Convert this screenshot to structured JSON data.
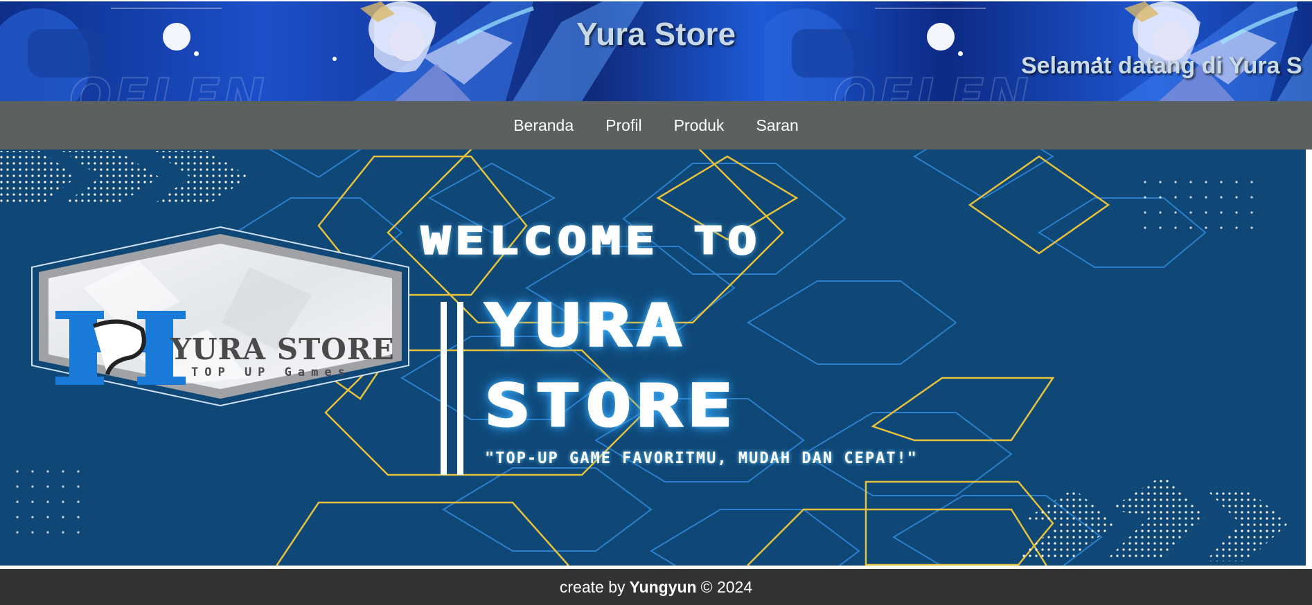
{
  "header": {
    "title": "Yura Store",
    "marquee": "Selamat datang di Yura S"
  },
  "nav": {
    "items": [
      "Beranda",
      "Profil",
      "Produk",
      "Saran"
    ]
  },
  "hero": {
    "welcome": "WELCOME TO",
    "name_line1": "YURA",
    "name_line2": "STORE",
    "tagline": "\"TOP-UP GAME FAVORITMU, MUDAH DAN CEPAT!\"",
    "logo": {
      "monogram": "YS",
      "title": "YURA STORE",
      "subtitle": "TOP UP Games"
    }
  },
  "footer": {
    "prefix": "create by",
    "author": "Yungyun",
    "suffix": "© 2024"
  },
  "colors": {
    "header_bg": "#1c4fc9",
    "nav_bg": "#5d6061",
    "hero_bg": "#0f4777",
    "hero_accent_yellow": "#e8c23a",
    "hero_accent_blue": "#2f86d6",
    "footer_bg": "#333333",
    "logo_blue": "#1a7ad8"
  }
}
